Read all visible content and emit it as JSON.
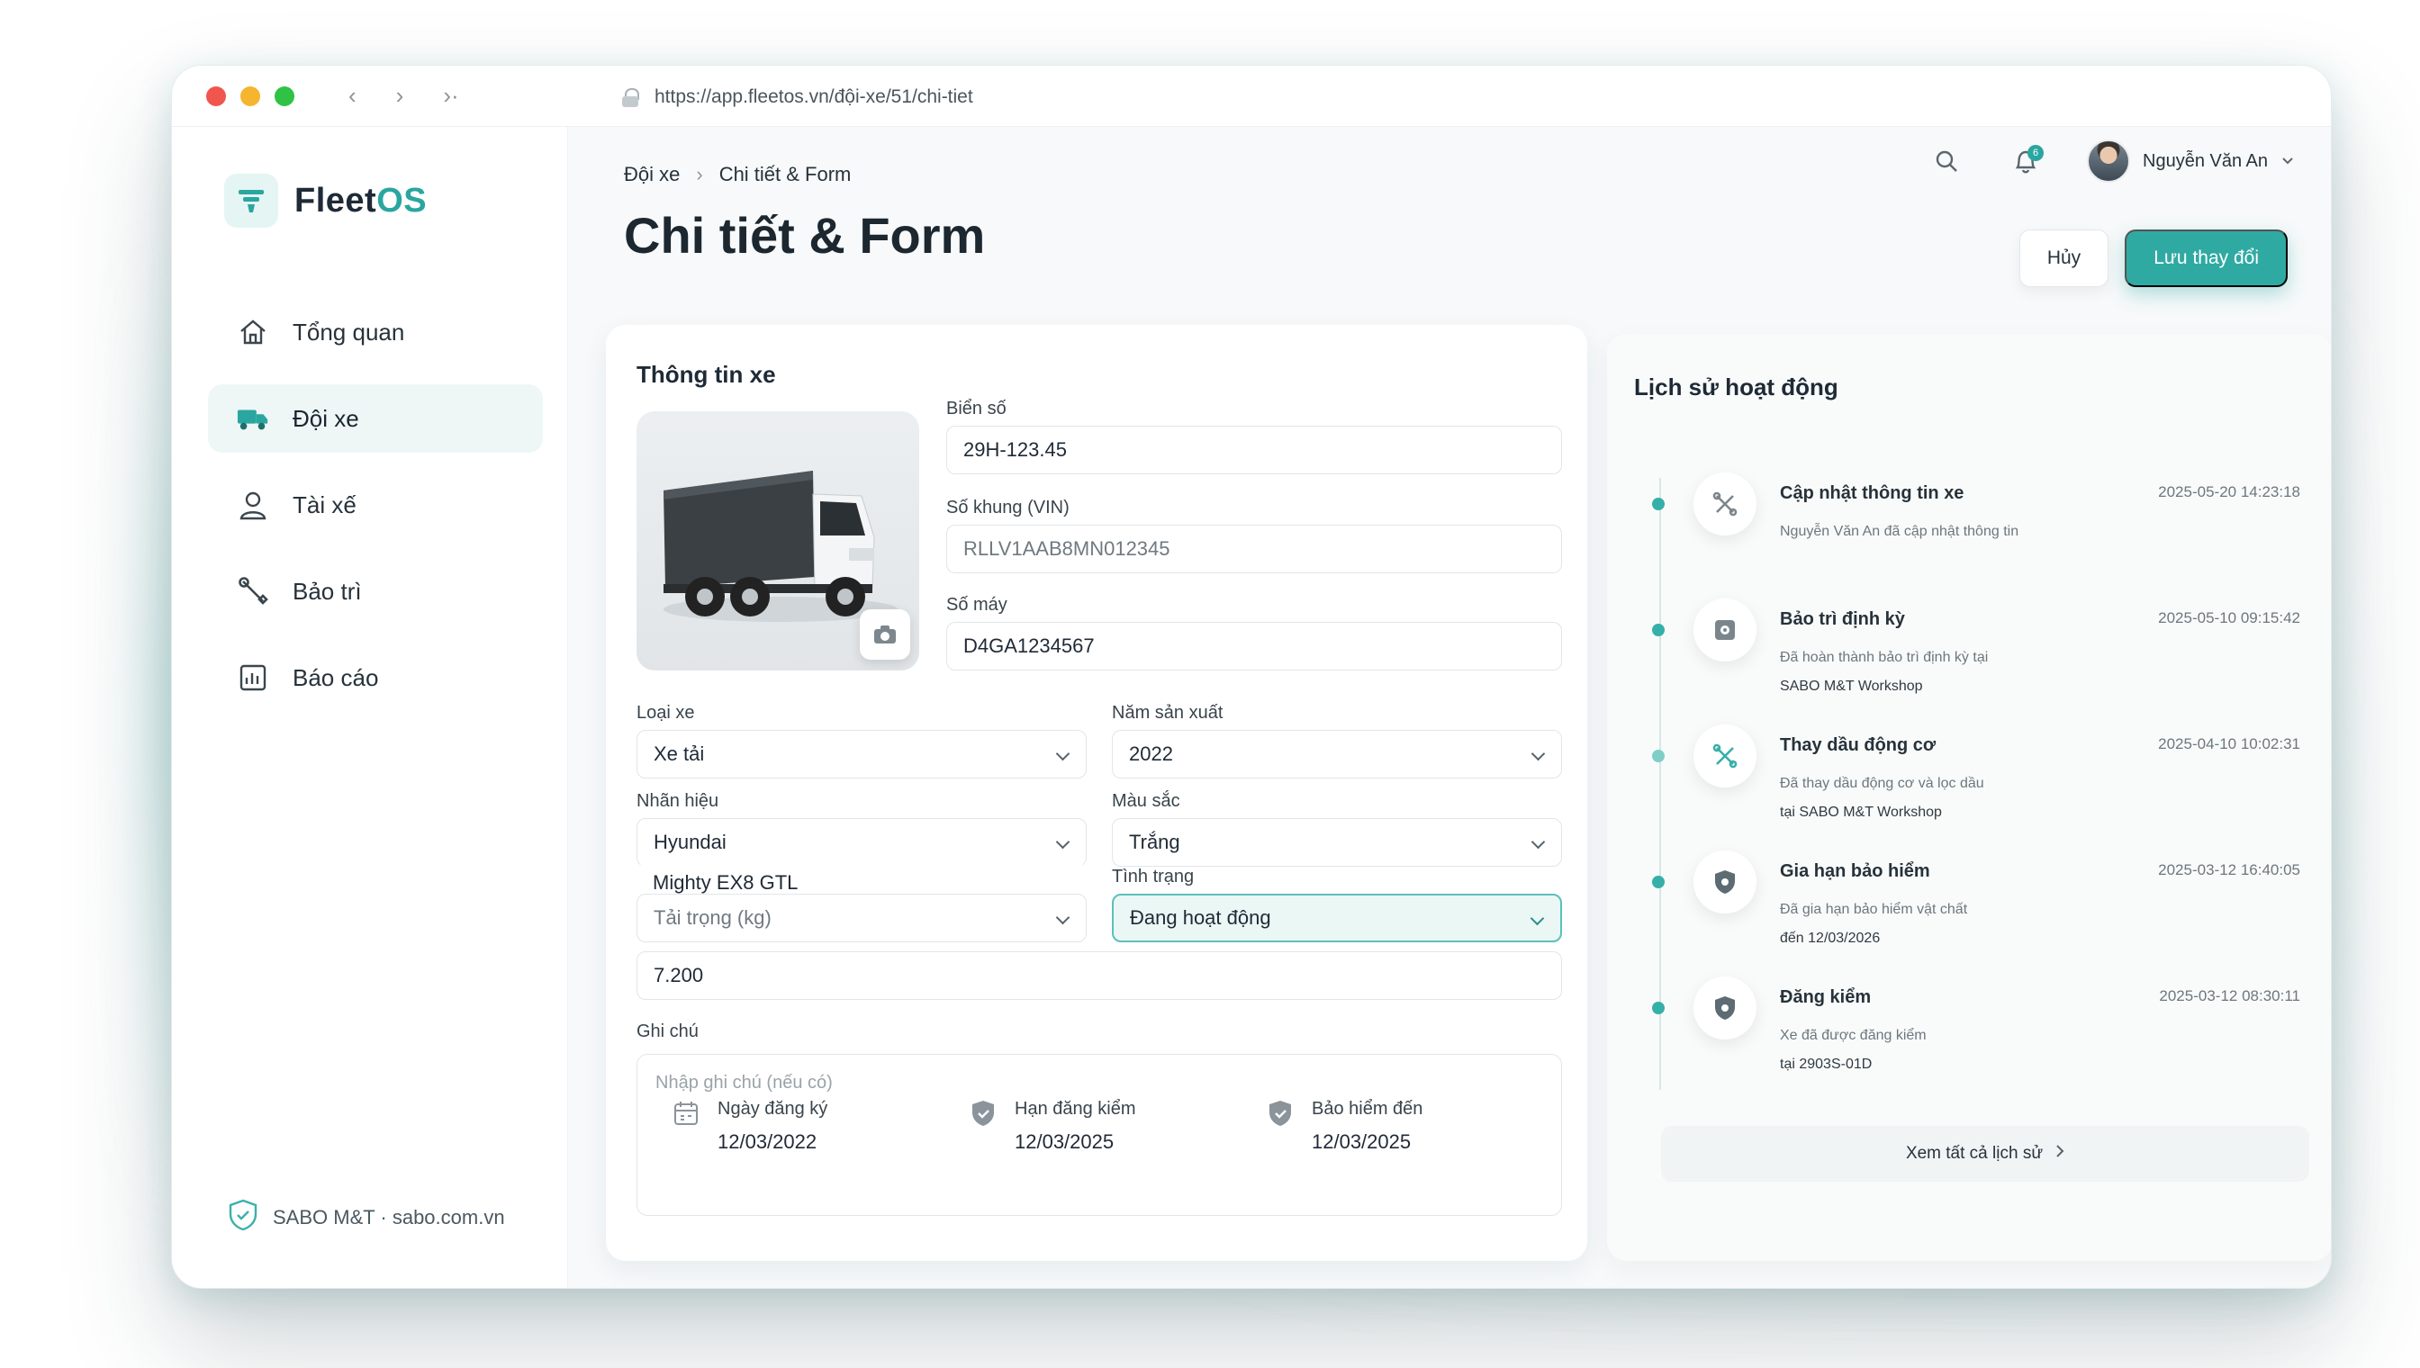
{
  "browser": {
    "url": "https://app.fleetos.vn/đội-xe/51/chi-tiet",
    "traffic_lights": [
      "#f0564d",
      "#f5b52e",
      "#2fc247"
    ]
  },
  "brand": {
    "name_part1": "Fleet",
    "name_part2": "OS",
    "accent": "#2aa6a0"
  },
  "sidebar": {
    "items": [
      {
        "label": "Tổng quan",
        "icon": "home-icon",
        "active": false
      },
      {
        "label": "Đội xe",
        "icon": "truck-icon",
        "active": true
      },
      {
        "label": "Tài xế",
        "icon": "user-icon",
        "active": false
      },
      {
        "label": "Bảo trì",
        "icon": "wrench-icon",
        "active": false
      },
      {
        "label": "Báo cáo",
        "icon": "report-icon",
        "active": false
      }
    ],
    "footer": "SABO M&T · sabo.com.vn"
  },
  "header": {
    "breadcrumb": [
      "Đội xe",
      "Chi tiết & Form"
    ],
    "title": "Chi tiết & Form",
    "notification_count": "6",
    "user_name": "Nguyễn Văn An",
    "cancel_label": "Hủy",
    "save_label": "Lưu thay đổi"
  },
  "form": {
    "title": "Thông tin xe",
    "plate": {
      "label": "Biển số",
      "value": "29H-123.45"
    },
    "vin": {
      "label": "Số khung (VIN)",
      "value": "RLLV1AAB8MN012345"
    },
    "engine": {
      "label": "Số máy",
      "value": "D4GA1234567"
    },
    "vehicle_type": {
      "label": "Loại xe",
      "value": "Xe tải"
    },
    "year": {
      "label": "Năm sản xuất",
      "value": "2022"
    },
    "brand": {
      "label": "Nhãn hiệu",
      "value": "Hyundai"
    },
    "model": {
      "value": "Mighty EX8 GTL"
    },
    "color": {
      "label": "Màu sắc",
      "value": "Trắng"
    },
    "status": {
      "label": "Tình trạng",
      "value": "Đang hoạt động"
    },
    "payload": {
      "label": "Tải trọng (kg)",
      "value": "7.200"
    },
    "note": {
      "label": "Ghi chú",
      "placeholder": "Nhập ghi chú (nếu có)"
    },
    "meta": [
      {
        "label": "Ngày đăng ký",
        "value": "12/03/2022",
        "icon": "calendar-icon"
      },
      {
        "label": "Hạn đăng kiểm",
        "value": "12/03/2025",
        "icon": "shield-check-icon"
      },
      {
        "label": "Bảo hiểm đến",
        "value": "12/03/2025",
        "icon": "shield-check-icon"
      }
    ]
  },
  "history": {
    "title": "Lịch sử hoạt động",
    "items": [
      {
        "title": "Cập nhật thông tin xe",
        "time": "2025-05-20 14:23:18",
        "desc": "Nguyễn Văn An đã cập nhật thông tin",
        "desc2": "",
        "icon": "tools-icon"
      },
      {
        "title": "Bảo trì định kỳ",
        "time": "2025-05-10 09:15:42",
        "desc": "Đã hoàn thành bảo trì định kỳ tại",
        "desc2": "SABO M&T Workshop",
        "icon": "maintenance-icon"
      },
      {
        "title": "Thay dầu động cơ",
        "time": "2025-04-10 10:02:31",
        "desc": "Đã thay dầu động cơ và lọc dầu",
        "desc2": "tại SABO M&T Workshop",
        "icon": "tools-icon"
      },
      {
        "title": "Gia hạn bảo hiểm",
        "time": "2025-03-12 16:40:05",
        "desc": "Đã gia hạn bảo hiểm vật chất",
        "desc2": "đến 12/03/2026",
        "icon": "shield-icon"
      },
      {
        "title": "Đăng kiểm",
        "time": "2025-03-12 08:30:11",
        "desc": "Xe đã được đăng kiểm",
        "desc2": "tại 2903S-01D",
        "icon": "shield-icon"
      }
    ],
    "see_all": "Xem tất cả lịch sử"
  }
}
